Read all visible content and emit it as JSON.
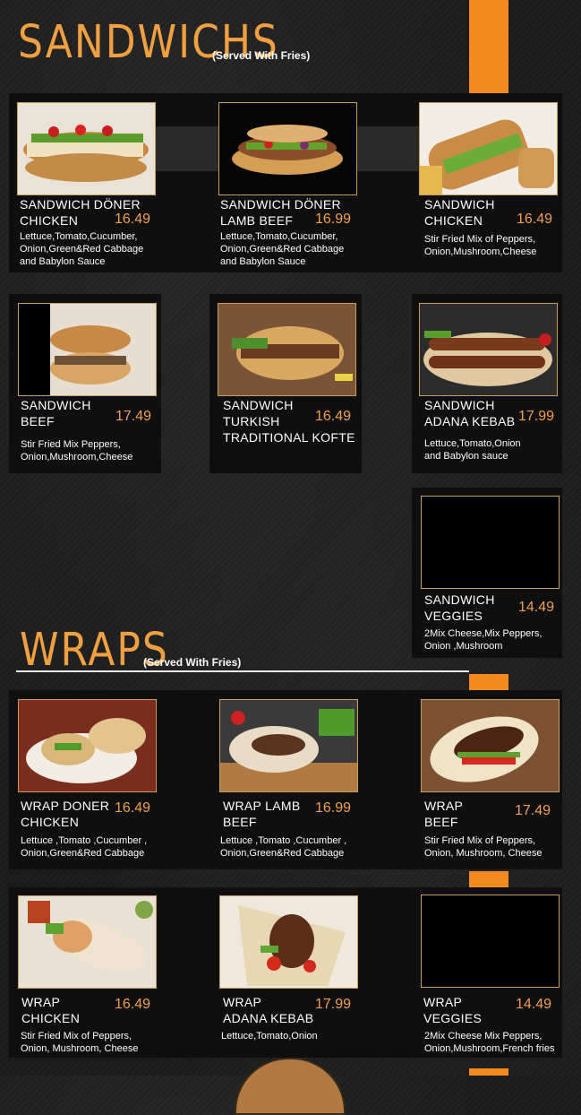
{
  "sandwiches": {
    "title": "SANDWICHS",
    "subtitle": "(Served With Fries)",
    "items": [
      {
        "name1": "SANDWICH DÖNER",
        "name2": "CHICKEN",
        "price": "16.49",
        "desc": [
          "Lettuce,Tomato,Cucumber,",
          "Onion,Green&Red Cabbage",
          "and Babylon Sauce"
        ]
      },
      {
        "name1": "SANDWICH DÖNER",
        "name2": "LAMB BEEF",
        "price": "16.99",
        "desc": [
          "Lettuce,Tomato,Cucumber,",
          "Onion,Green&Red Cabbage",
          "and Babylon Sauce"
        ]
      },
      {
        "name1": "SANDWICH",
        "name2": "CHICKEN",
        "price": "16.49",
        "desc": [
          "Stir Fried Mix of Peppers,",
          "Onion,Mushroom,Cheese"
        ]
      },
      {
        "name1": "SANDWICH",
        "name2": "BEEF",
        "price": "17.49",
        "desc": [
          "Stir Fried Mix Peppers,",
          "Onion,Mushroom,Cheese"
        ]
      },
      {
        "name1": "SANDWICH",
        "name2": "TURKISH",
        "name3": "TRADITIONAL KOFTE",
        "price": "16.49",
        "desc": []
      },
      {
        "name1": "SANDWICH",
        "name2": "ADANA KEBAB",
        "price": "17.99",
        "desc": [
          "Lettuce,Tomato,Onion",
          "and Babylon sauce"
        ]
      },
      {
        "name1": "SANDWICH",
        "name2": "VEGGIES",
        "price": "14.49",
        "desc": [
          "2Mix Cheese,Mix Peppers,",
          "Onion ,Mushroom"
        ]
      }
    ]
  },
  "wraps": {
    "title": "WRAPS",
    "subtitle": "(Served With Fries)",
    "items": [
      {
        "name1": "WRAP DONER",
        "name2": "CHICKEN",
        "price": "16.49",
        "desc": [
          "Lettuce ,Tomato ,Cucumber ,",
          "Onion,Green&Red Cabbage"
        ]
      },
      {
        "name1": "WRAP LAMB",
        "name2": "BEEF",
        "price": "16.99",
        "desc": [
          "Lettuce ,Tomato ,Cucumber ,",
          "Onion,Green&Red Cabbage"
        ]
      },
      {
        "name1": "WRAP",
        "name2": "BEEF",
        "price": "17.49",
        "desc": [
          "Stir Fried Mix of Peppers,",
          "Onion, Mushroom, Cheese"
        ]
      },
      {
        "name1": "WRAP",
        "name2": "CHICKEN",
        "price": "16.49",
        "desc": [
          "Stir Fried Mix of Peppers,",
          "Onion, Mushroom, Cheese"
        ]
      },
      {
        "name1": "WRAP",
        "name2": "ADANA KEBAB",
        "price": "17.99",
        "desc": [
          "Lettuce,Tomato,Onion"
        ]
      },
      {
        "name1": "WRAP",
        "name2": "VEGGIES",
        "price": "14.49",
        "desc": [
          "2Mix Cheese Mix Peppers,",
          "Onion,Mushroom,French fries"
        ]
      }
    ]
  },
  "colors": {
    "accent": "#f58b1f",
    "price": "#f0a050",
    "gold_border": "#c6a15a"
  }
}
